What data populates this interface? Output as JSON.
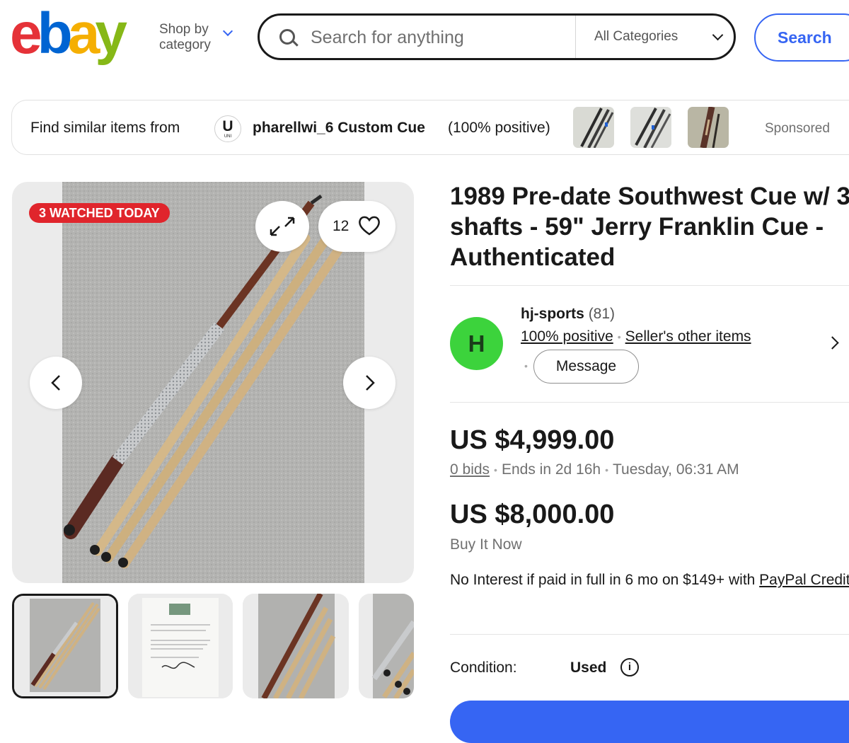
{
  "header": {
    "logo_letters": [
      "e",
      "b",
      "a",
      "y"
    ],
    "shop_by_line1": "Shop by",
    "shop_by_line2": "category",
    "search_placeholder": "Search for anything",
    "category_select": "All Categories",
    "search_button": "Search"
  },
  "similar_bar": {
    "label": "Find similar items from",
    "badge_letter": "U",
    "badge_sub": "UNI",
    "seller_name": "pharellwi_6 Custom Cue",
    "positive": "(100% positive)",
    "sponsored": "Sponsored"
  },
  "gallery": {
    "watched_badge": "3 WATCHED TODAY",
    "watch_count": "12",
    "thumbnail_count_visible": 4,
    "selected_thumbnail": 1
  },
  "item": {
    "title": "1989 Pre-date Southwest Cue w/ 3 shafts - 59\" Jerry Franklin Cue - Authenticated"
  },
  "seller": {
    "avatar_letter": "H",
    "name": "hj-sports",
    "feedback_count": "(81)",
    "positive_link": "100% positive",
    "other_items_link": "Seller's other items",
    "message_button": "Message"
  },
  "pricing": {
    "current_price": "US $4,999.00",
    "bids_link": "0 bids",
    "ends_in": "Ends in 2d 16h",
    "end_time": "Tuesday, 06:31 AM",
    "buy_now_price": "US $8,000.00",
    "buy_now_label": "Buy It Now",
    "credit_text": "No Interest if paid in full in 6 mo on $149+ with ",
    "credit_link": "PayPal Credit",
    "credit_suffix": "*"
  },
  "condition": {
    "label": "Condition:",
    "value": "Used"
  },
  "colors": {
    "ebay_red": "#e53238",
    "ebay_blue": "#0064d2",
    "ebay_yellow": "#f5af02",
    "ebay_green": "#86b817",
    "accent_blue": "#3665f3",
    "watched_red": "#e0252c",
    "avatar_green": "#3cd33c"
  }
}
